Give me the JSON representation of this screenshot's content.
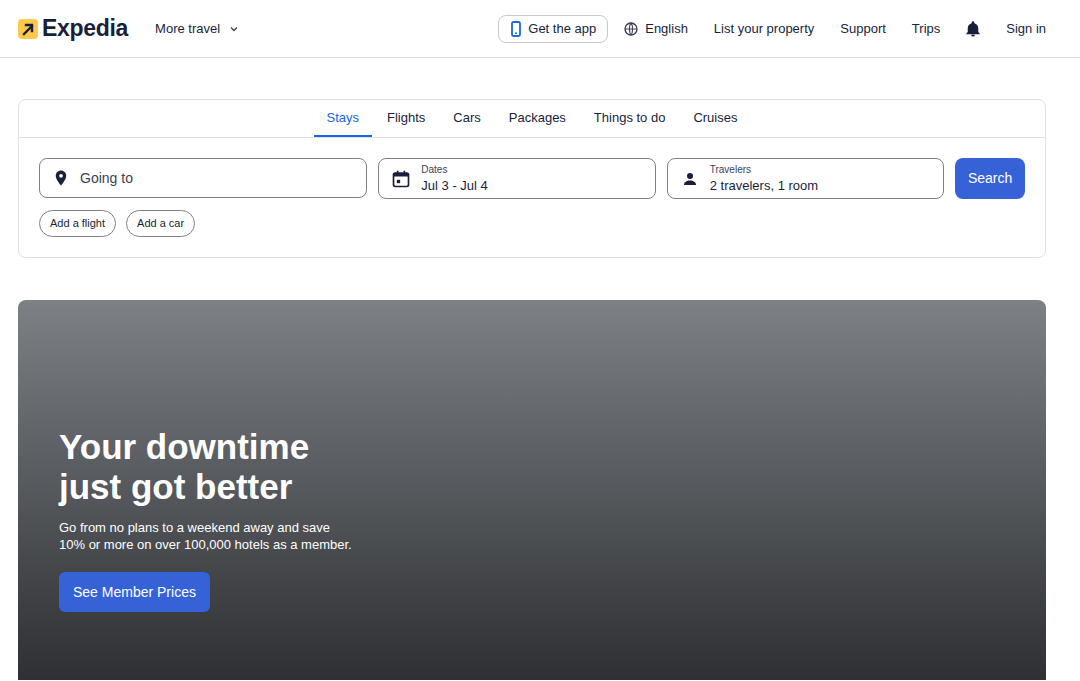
{
  "header": {
    "logo": "Expedia",
    "more_travel": "More travel",
    "get_app": "Get the app",
    "language": "English",
    "nav": [
      "List your property",
      "Support",
      "Trips"
    ],
    "sign_in": "Sign in"
  },
  "search": {
    "tabs": [
      {
        "label": "Stays",
        "selected": true
      },
      {
        "label": "Flights",
        "selected": false
      },
      {
        "label": "Cars",
        "selected": false
      },
      {
        "label": "Packages",
        "selected": false
      },
      {
        "label": "Things to do",
        "selected": false
      },
      {
        "label": "Cruises",
        "selected": false
      }
    ],
    "destination": {
      "placeholder": "Going to"
    },
    "dates": {
      "label": "Dates",
      "value": "Jul 3 - Jul 4"
    },
    "travelers": {
      "label": "Travelers",
      "value": "2 travelers, 1 room"
    },
    "button": "Search",
    "addons": [
      "Add a flight",
      "Add a car"
    ]
  },
  "hero": {
    "title": [
      "Your downtime",
      "just got better"
    ],
    "subtitle": [
      "Go from no plans to a weekend away and save",
      "10% or more on over 100,000 hotels as a member."
    ],
    "button": "See Member Prices"
  }
}
